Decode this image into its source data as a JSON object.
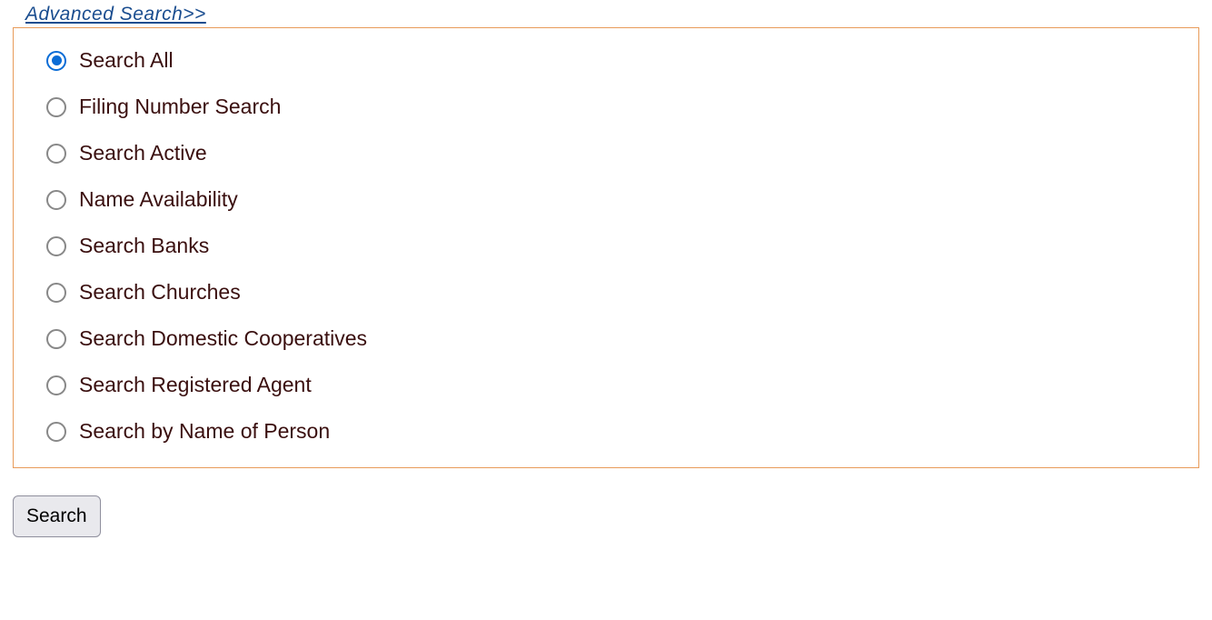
{
  "header": {
    "advanced_search_label": "Advanced Search>>"
  },
  "options": [
    {
      "label": "Search All",
      "selected": true
    },
    {
      "label": "Filing Number Search",
      "selected": false
    },
    {
      "label": "Search Active",
      "selected": false
    },
    {
      "label": "Name Availability",
      "selected": false
    },
    {
      "label": "Search Banks",
      "selected": false
    },
    {
      "label": "Search Churches",
      "selected": false
    },
    {
      "label": "Search Domestic Cooperatives",
      "selected": false
    },
    {
      "label": "Search Registered Agent",
      "selected": false
    },
    {
      "label": "Search by Name of Person",
      "selected": false
    }
  ],
  "buttons": {
    "search_label": "Search"
  }
}
